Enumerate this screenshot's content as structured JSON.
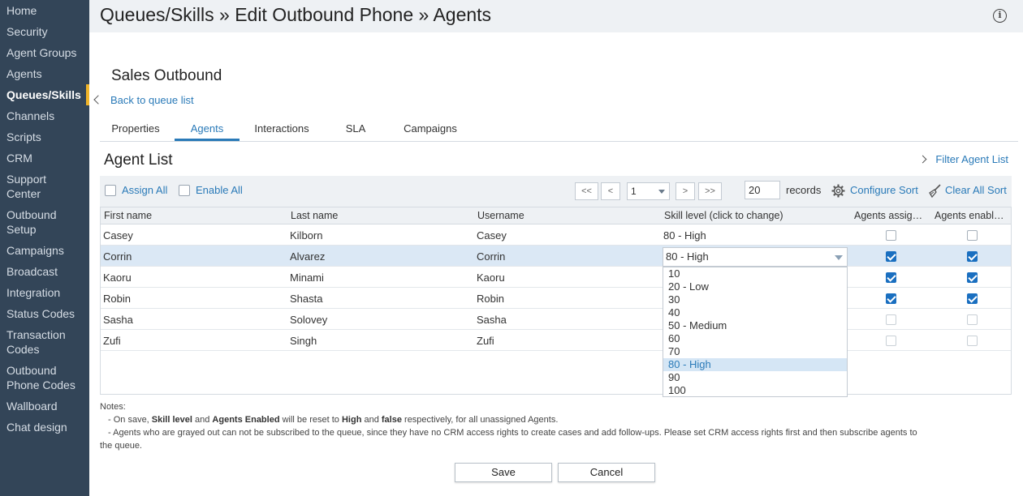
{
  "sidebar": {
    "items": [
      {
        "label": "Home"
      },
      {
        "label": "Security"
      },
      {
        "label": "Agent Groups"
      },
      {
        "label": "Agents"
      },
      {
        "label": "Queues/Skills",
        "active": true
      },
      {
        "label": "Channels"
      },
      {
        "label": "Scripts"
      },
      {
        "label": "CRM"
      },
      {
        "label": "Support\nCenter"
      },
      {
        "label": "Outbound\nSetup"
      },
      {
        "label": "Campaigns"
      },
      {
        "label": "Broadcast"
      },
      {
        "label": "Integration"
      },
      {
        "label": "Status Codes"
      },
      {
        "label": "Transaction\nCodes"
      },
      {
        "label": "Outbound\nPhone Codes"
      },
      {
        "label": "Wallboard"
      },
      {
        "label": "Chat design"
      }
    ]
  },
  "header": {
    "title": "Queues/Skills » Edit Outbound Phone » Agents",
    "info_icon": "i"
  },
  "queue": {
    "name": "Sales Outbound",
    "back_link": "Back to queue list"
  },
  "tabs": [
    {
      "label": "Properties"
    },
    {
      "label": "Agents",
      "active": true
    },
    {
      "label": "Interactions"
    },
    {
      "label": "SLA"
    },
    {
      "label": "Campaigns"
    }
  ],
  "agent_list": {
    "title": "Agent List",
    "filter_link": "Filter Agent List"
  },
  "toolbar": {
    "assign_all": "Assign All",
    "enable_all": "Enable All",
    "first_btn": "<<",
    "prev_btn": "<",
    "page_value": "1",
    "next_btn": ">",
    "last_btn": ">>",
    "records_value": "20",
    "records_label": "records",
    "configure_sort": "Configure Sort",
    "clear_all_sort": "Clear All Sort"
  },
  "table": {
    "headers": {
      "first_name": "First name",
      "last_name": "Last name",
      "username": "Username",
      "skill_level": "Skill level (click to change)",
      "agents_assigned": "Agents assig…",
      "agents_enabled": "Agents enabl…"
    },
    "rows": [
      {
        "first": "Casey",
        "last": "Kilborn",
        "user": "Casey",
        "skill": "80 - High",
        "assigned": false,
        "enabled": false
      },
      {
        "first": "Corrin",
        "last": "Alvarez",
        "user": "Corrin",
        "skill": "80 - High",
        "assigned": true,
        "enabled": true
      },
      {
        "first": "Kaoru",
        "last": "Minami",
        "user": "Kaoru",
        "skill": "",
        "assigned": true,
        "enabled": true
      },
      {
        "first": "Robin",
        "last": "Shasta",
        "user": "Robin",
        "skill": "",
        "assigned": true,
        "enabled": true
      },
      {
        "first": "Sasha",
        "last": "Solovey",
        "user": "Sasha",
        "skill": "",
        "assigned": false,
        "enabled": false
      },
      {
        "first": "Zufi",
        "last": "Singh",
        "user": "Zufi",
        "skill": "",
        "assigned": false,
        "enabled": false
      }
    ]
  },
  "skill_dropdown": {
    "selected": "80 - High",
    "options": [
      "10",
      "20 - Low",
      "30",
      "40",
      "50 - Medium",
      "60",
      "70",
      "80 - High",
      "90",
      "100"
    ]
  },
  "notes": {
    "heading": "Notes:",
    "line1_a": "- On save, ",
    "line1_b": "Skill level",
    "line1_c": " and ",
    "line1_d": "Agents Enabled",
    "line1_e": " will be reset to ",
    "line1_f": "High",
    "line1_g": " and ",
    "line1_h": "false",
    "line1_i": " respectively, for all unassigned Agents.",
    "line2": "- Agents who are grayed out can not be subscribed to the queue, since they have no CRM access rights to create cases and add follow-ups. Please set CRM access rights first and then subscribe agents to the queue."
  },
  "buttons": {
    "save": "Save",
    "cancel": "Cancel"
  },
  "colors": {
    "sidebar_bg": "#334558",
    "accent": "#f0b429",
    "link": "#2a7ab8",
    "checked": "#1a6fc0"
  }
}
